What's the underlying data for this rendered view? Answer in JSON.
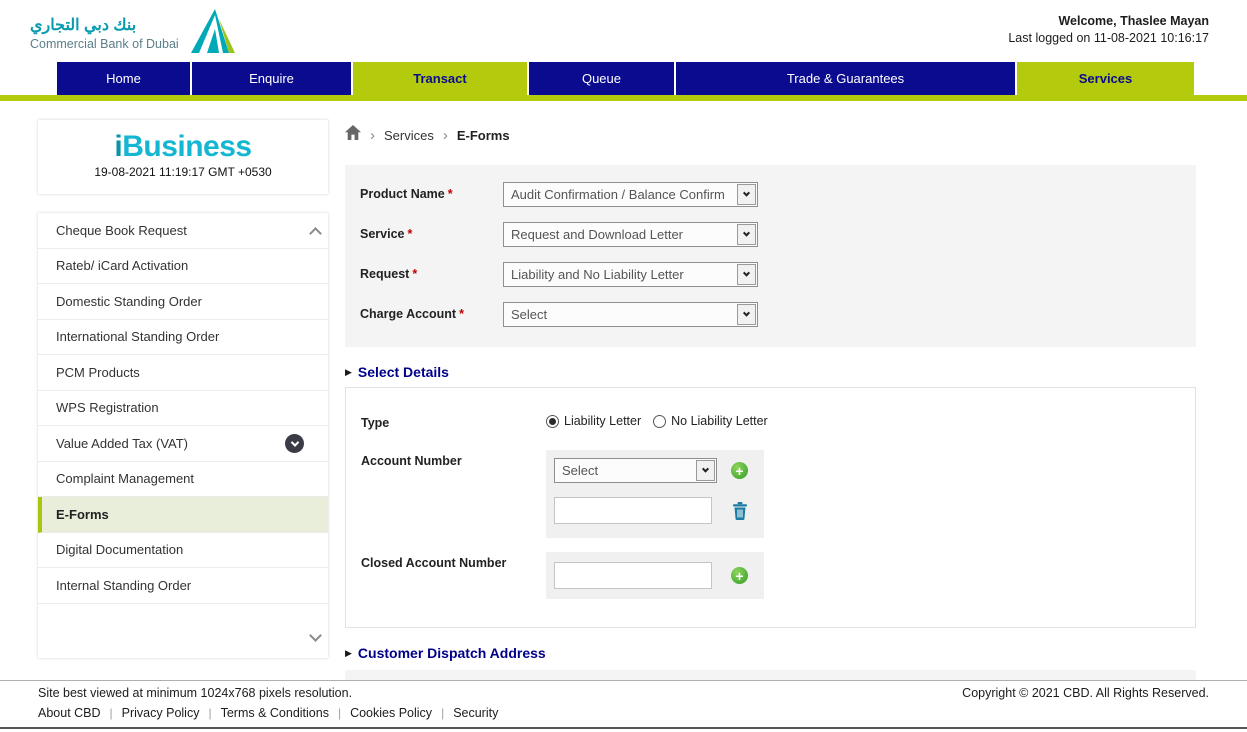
{
  "header": {
    "bank_name_arabic": "بنك دبي التجاري",
    "bank_name_english": "Commercial Bank of Dubai",
    "welcome": "Welcome, Thaslee Mayan",
    "last_logged": "Last logged on 11-08-2021 10:16:17"
  },
  "nav": {
    "items": [
      {
        "label": "Home"
      },
      {
        "label": "Enquire"
      },
      {
        "label": "Transact"
      },
      {
        "label": "Queue"
      },
      {
        "label": "Trade & Guarantees"
      },
      {
        "label": "Services"
      }
    ]
  },
  "sidebar": {
    "logo_i": "i",
    "logo_rest": "Business",
    "datetime": "19-08-2021 11:19:17 GMT +0530",
    "items": [
      {
        "label": "Cheque Book Request"
      },
      {
        "label": "Rateb/ iCard Activation"
      },
      {
        "label": "Domestic Standing Order"
      },
      {
        "label": "International Standing Order"
      },
      {
        "label": "PCM Products"
      },
      {
        "label": "WPS Registration"
      },
      {
        "label": "Value Added Tax (VAT)"
      },
      {
        "label": "Complaint Management"
      },
      {
        "label": "E-Forms"
      },
      {
        "label": "Digital Documentation"
      },
      {
        "label": "Internal Standing Order"
      }
    ]
  },
  "breadcrumb": {
    "separator": "›",
    "level1": "Services",
    "level2": "E-Forms"
  },
  "form": {
    "required_mark": "*",
    "fields": [
      {
        "label": "Product Name",
        "value": "Audit Confirmation / Balance Confirm"
      },
      {
        "label": "Service",
        "value": "Request and Download Letter"
      },
      {
        "label": "Request",
        "value": "Liability and No Liability Letter"
      },
      {
        "label": "Charge Account",
        "value": "Select"
      }
    ]
  },
  "select_details": {
    "title": "Select Details",
    "type_label": "Type",
    "radio1": "Liability Letter",
    "radio2": "No Liability Letter",
    "account_label": "Account Number",
    "account_select_value": "Select",
    "account_input_value": "",
    "closed_account_label": "Closed Account Number",
    "closed_account_input_value": ""
  },
  "dispatch_section": {
    "title": "Customer Dispatch Address"
  },
  "footer": {
    "note": "Site best viewed at minimum 1024x768 pixels resolution.",
    "copyright": "Copyright © 2021 CBD. All Rights Reserved.",
    "separator": "|",
    "links": [
      {
        "label": "About CBD"
      },
      {
        "label": "Privacy Policy"
      },
      {
        "label": "Terms & Conditions"
      },
      {
        "label": "Cookies Policy"
      },
      {
        "label": "Security"
      }
    ]
  },
  "icons": {
    "plus": "+",
    "section_arrow": "▶"
  },
  "colors": {
    "navy": "#0b0b8f",
    "lime": "#b3cb0c",
    "teal_logo": "#00a9b7",
    "section_title_blue": "#00008b",
    "plus_green": "#2f9e27",
    "trash_teal": "#1b7ca3",
    "required_red": "#c00000"
  }
}
